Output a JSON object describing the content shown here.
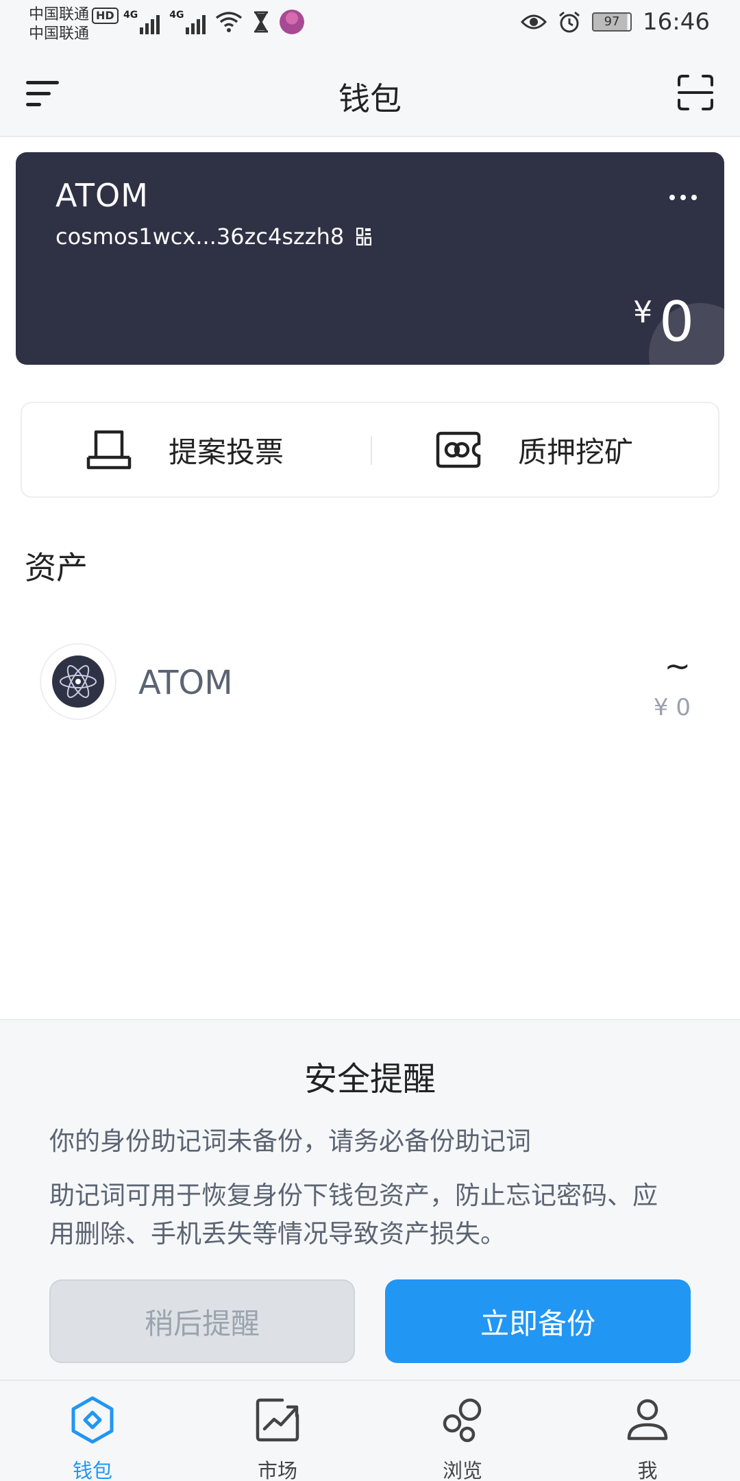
{
  "status_bar": {
    "carrier1": "中国联通",
    "carrier2": "中国联通",
    "hd_badge": "HD",
    "net1": "4G",
    "net2": "4G",
    "battery": "97",
    "time": "16:46"
  },
  "header": {
    "title": "钱包",
    "icons": [
      "menu-icon",
      "scan-icon"
    ]
  },
  "card": {
    "token": "ATOM",
    "address": "cosmos1wcx...36zc4szzh8",
    "currency_symbol": "¥",
    "balance": "0",
    "color": "#2f3245"
  },
  "actions": [
    {
      "label": "提案投票",
      "icon": "ballot-box-icon"
    },
    {
      "label": "质押挖矿",
      "icon": "staking-ticket-icon"
    }
  ],
  "assets": {
    "section_title": "资产",
    "items": [
      {
        "name": "ATOM",
        "amount": "~",
        "value": "¥ 0",
        "icon": "cosmos-atom-logo"
      }
    ]
  },
  "security_sheet": {
    "title": "安全提醒",
    "line1": "你的身份助记词未备份，请务必备份助记词",
    "line2": "助记词可用于恢复身份下钱包资产，防止忘记密码、应用删除、手机丢失等情况导致资产损失。",
    "later_button": "稍后提醒",
    "backup_button": "立即备份",
    "accent": "#2196f3"
  },
  "tabbar": {
    "tabs": [
      {
        "label": "钱包",
        "icon": "wallet-diamond-icon",
        "active": true
      },
      {
        "label": "市场",
        "icon": "market-chart-icon",
        "active": false
      },
      {
        "label": "浏览",
        "icon": "browse-bubbles-icon",
        "active": false
      },
      {
        "label": "我",
        "icon": "person-icon",
        "active": false
      }
    ]
  }
}
